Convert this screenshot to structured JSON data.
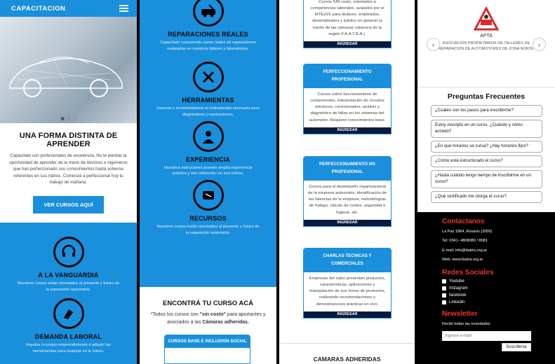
{
  "col1": {
    "brand": "CAPACITACION",
    "headline": "UNA FORMA DISTINTA DE APRENDER",
    "intro": "Capacitate con profesionales de excelencia. No te pierdas la oportunidad de aprender de la mano de técnicos e ingenieros que han perfeccionado sus conocimientos hasta volverse referentes en sus rubros. Comenzá a perfeccionar hoy tu trabajo de mañana.",
    "cta": "VER CURSOS AQUÍ",
    "features": [
      {
        "title": "A LA VANGUARDIA",
        "desc": "Nuestros cursos están orientados al presente y futuro de la reparación automotriz.",
        "icon": "headset-icon"
      },
      {
        "title": "DEMANDA LABORAL",
        "desc": "Impulsa tu propio emprendimiento o adquirí las herramientas para avanzar en tu futuro.",
        "icon": "hand-icon"
      }
    ]
  },
  "col2": {
    "features": [
      {
        "title": "REPARACIONES REALES",
        "desc": "Capacitate conociendo casos reales de reparaciones realizadas en nuestros talleres y laboratorios.",
        "icon": "car-repair-icon"
      },
      {
        "title": "HERRAMIENTAS",
        "desc": "Usamos y recomendamos el instrumental necesario para diagnósticos y reparaciones.",
        "icon": "tools-icon"
      },
      {
        "title": "EXPERIENCIA",
        "desc": "Nuestros instructores poseen amplia experiencia práctica y son referentes en sus rubros.",
        "icon": "expert-icon"
      },
      {
        "title": "RECURSOS",
        "desc": "Nuestros cursos están orientados al presente y futuro de la reparación automotriz.",
        "icon": "resources-icon"
      }
    ],
    "find_title": "ENCONTRÁ TU CURSO ACÁ",
    "find_text_1": "*Todos los cursos son ",
    "find_bold": "\"sin costo\"",
    "find_text_2": " para aportantes y asociados a las ",
    "find_bold_2": "Cámaras adheridas.",
    "first_card": "CURSOS BASE E INCLUSION SOCIAL"
  },
  "col3": {
    "top_text": "Cursos SIN costo, orientados a competencias laborales, avalados por el MTEySS para titulares, empleados, desempleados y público en general (a través de las cámaras cabecera de la región F.A.A.T.R.A.).",
    "enroll": "INGRESAR",
    "cards": [
      {
        "title": "PERFECCIONAMIENTO PROFESIONAL",
        "body": "Cursos sobre funcionamiento de componentes, interpretación de circuitos eléctricos, conexionados, análisis y diagnóstico de fallas en los sistemas del automotor. Requiere conocimientos base."
      },
      {
        "title": "PERFECCIONAMIENTO NO PROFESIONAL",
        "body": "Cursos para el desempeño organizacional de la empresa automotriz, identificación de las falencias de la empresa, metodologías de trabajo, cálculo de costos, seguridad e higiene, etc."
      },
      {
        "title": "CHARLAS TECNICAS Y COMERCIALES",
        "body": "Empresas del rubro presentan productos, características, aplicaciones y manipulación de sus líneas de productos, realizando recomendaciones y demostraciones prácticas en vivo."
      }
    ],
    "camaras": "CAMARAS ADHERIDAS"
  },
  "col4": {
    "logo_label": "APTA",
    "assoc": "ASOCIACION PROPIETARIOS DE TALLERES DE REPARACION DE AUTOMOTORES DE ZONA NORTE",
    "faq_title": "Preguntas Frecuentes",
    "faqs": [
      "¿Cuales son los pasos para inscribirme?",
      "Estoy inscripto en un curso. ¿Cuándo y cómo accedo?",
      "¿En qué horarios se cursa? ¿Hay horarios fijos?",
      "¿Cómo está estructurado el curso?",
      "¿Hasta cuándo tengo tiempo de inscribirme en un curso?",
      "¿Qué certificado me otorga el curso?"
    ],
    "contact_title": "Contactanos",
    "address": "La Paz 1864, Rosario (2000)",
    "phone": "Tel: 0341- 4808080 / 8081",
    "email": "E-mail: info@faatra.org.ar",
    "web": "Web: www.faatra.org.ar",
    "social_title": "Redes Sociales",
    "socials": [
      "Youtube",
      "Instagram",
      "facebook",
      "Linkedin"
    ],
    "newsletter_title": "Newsletter",
    "newsletter_text": "Recibí todas las novedades",
    "email_placeholder": "Ingrese e-mail",
    "subscribe": "Suscribirse"
  }
}
